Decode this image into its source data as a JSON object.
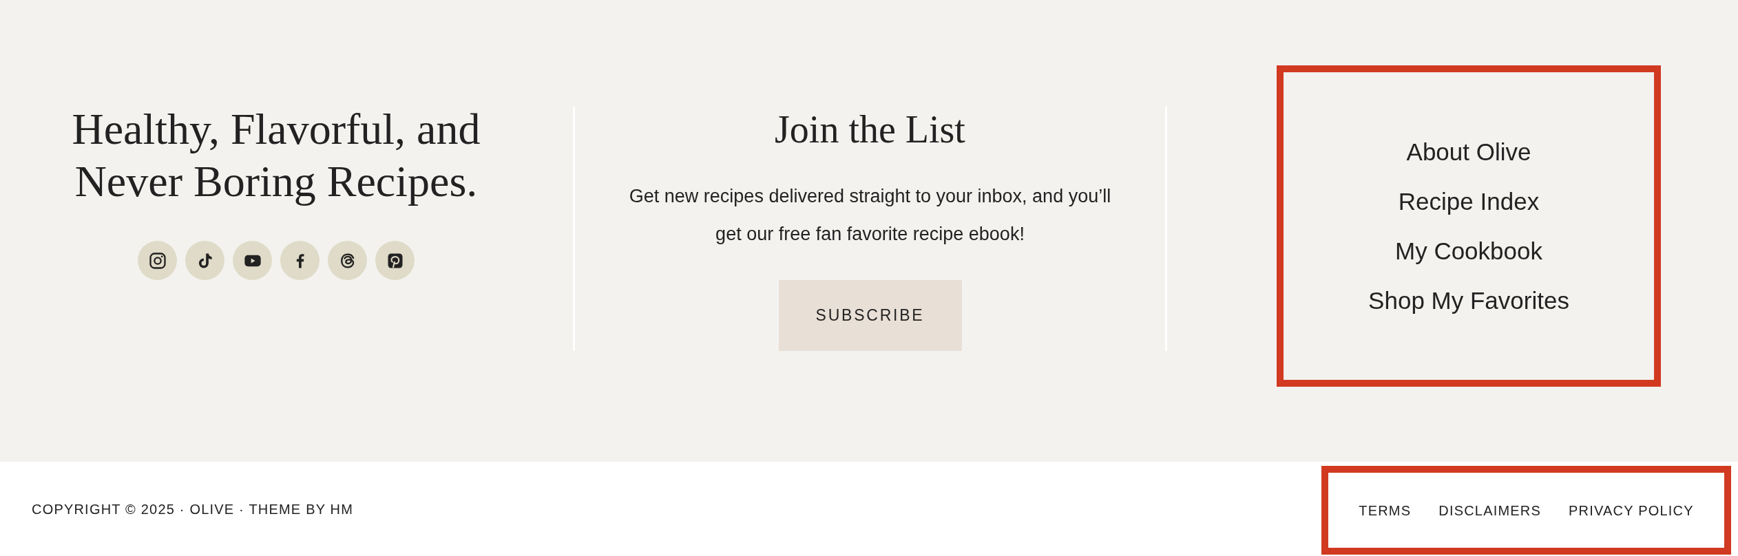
{
  "intro": {
    "heading": "Healthy, Flavorful, and Never Boring Recipes.",
    "social_links": [
      {
        "kind": "instagram"
      },
      {
        "kind": "tiktok"
      },
      {
        "kind": "youtube"
      },
      {
        "kind": "facebook"
      },
      {
        "kind": "threads"
      },
      {
        "kind": "pinterest"
      }
    ]
  },
  "newsletter": {
    "title": "Join the List",
    "text": "Get new recipes delivered straight to your inbox, and you’ll get our free fan favorite recipe ebook!",
    "button": "SUBSCRIBE"
  },
  "nav": {
    "highlighted": true,
    "items": [
      "About Olive",
      "Recipe Index",
      "My Cookbook",
      "Shop My Favorites"
    ]
  },
  "footer": {
    "copyright": "COPYRIGHT © 2025 · OLIVE · THEME BY HM",
    "legal_links": {
      "highlighted": true,
      "items": [
        "TERMS",
        "DISCLAIMERS",
        "PRIVACY POLICY"
      ]
    }
  }
}
